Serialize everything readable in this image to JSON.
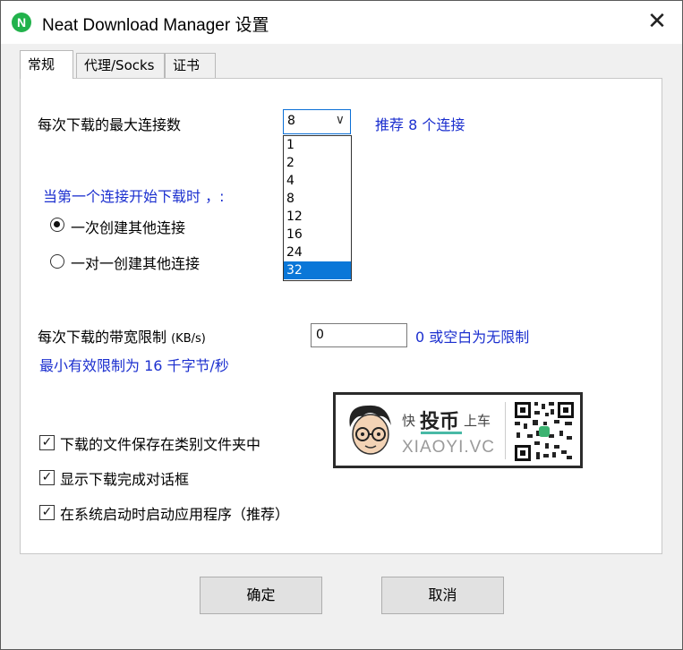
{
  "window": {
    "app_icon_letter": "N",
    "title": "Neat Download Manager 设置",
    "close_glyph": "✕"
  },
  "tabs": [
    {
      "label": "常规",
      "active": true
    },
    {
      "label": "代理/Socks",
      "active": false
    },
    {
      "label": "证书",
      "active": false
    }
  ],
  "connections": {
    "label": "每次下载的最大连接数",
    "selected": "8",
    "arrow_glyph": "∨",
    "recommend": "推荐 8 个连接",
    "options": [
      "1",
      "2",
      "4",
      "8",
      "12",
      "16",
      "24",
      "32"
    ],
    "highlighted_option": "32"
  },
  "first_connection": {
    "label": "当第一个连接开始下载时 ，:",
    "options": [
      {
        "label": "一次创建其他连接",
        "checked": true
      },
      {
        "label": "一对一创建其他连接",
        "checked": false
      }
    ]
  },
  "bandwidth": {
    "label": "每次下载的带宽限制",
    "unit": "(KB/s)",
    "value": "0",
    "hint": "0 或空白为无限制",
    "min_hint": "最小有效限制为 16 千字节/秒"
  },
  "checkboxes": [
    {
      "label": "下载的文件保存在类别文件夹中",
      "checked": true
    },
    {
      "label": "显示下载完成对话框",
      "checked": true
    },
    {
      "label": "在系统启动时启动应用程序（推荐）",
      "checked": true
    }
  ],
  "watermark": {
    "kuai": "快",
    "tou": "投币",
    "shang": "上车",
    "domain": "XIAOYI.VC"
  },
  "buttons": {
    "ok": "确定",
    "cancel": "取消"
  },
  "colors": {
    "accent_blue": "#1b2fcf",
    "selection": "#0a77d8",
    "app_icon": "#22b24c"
  }
}
